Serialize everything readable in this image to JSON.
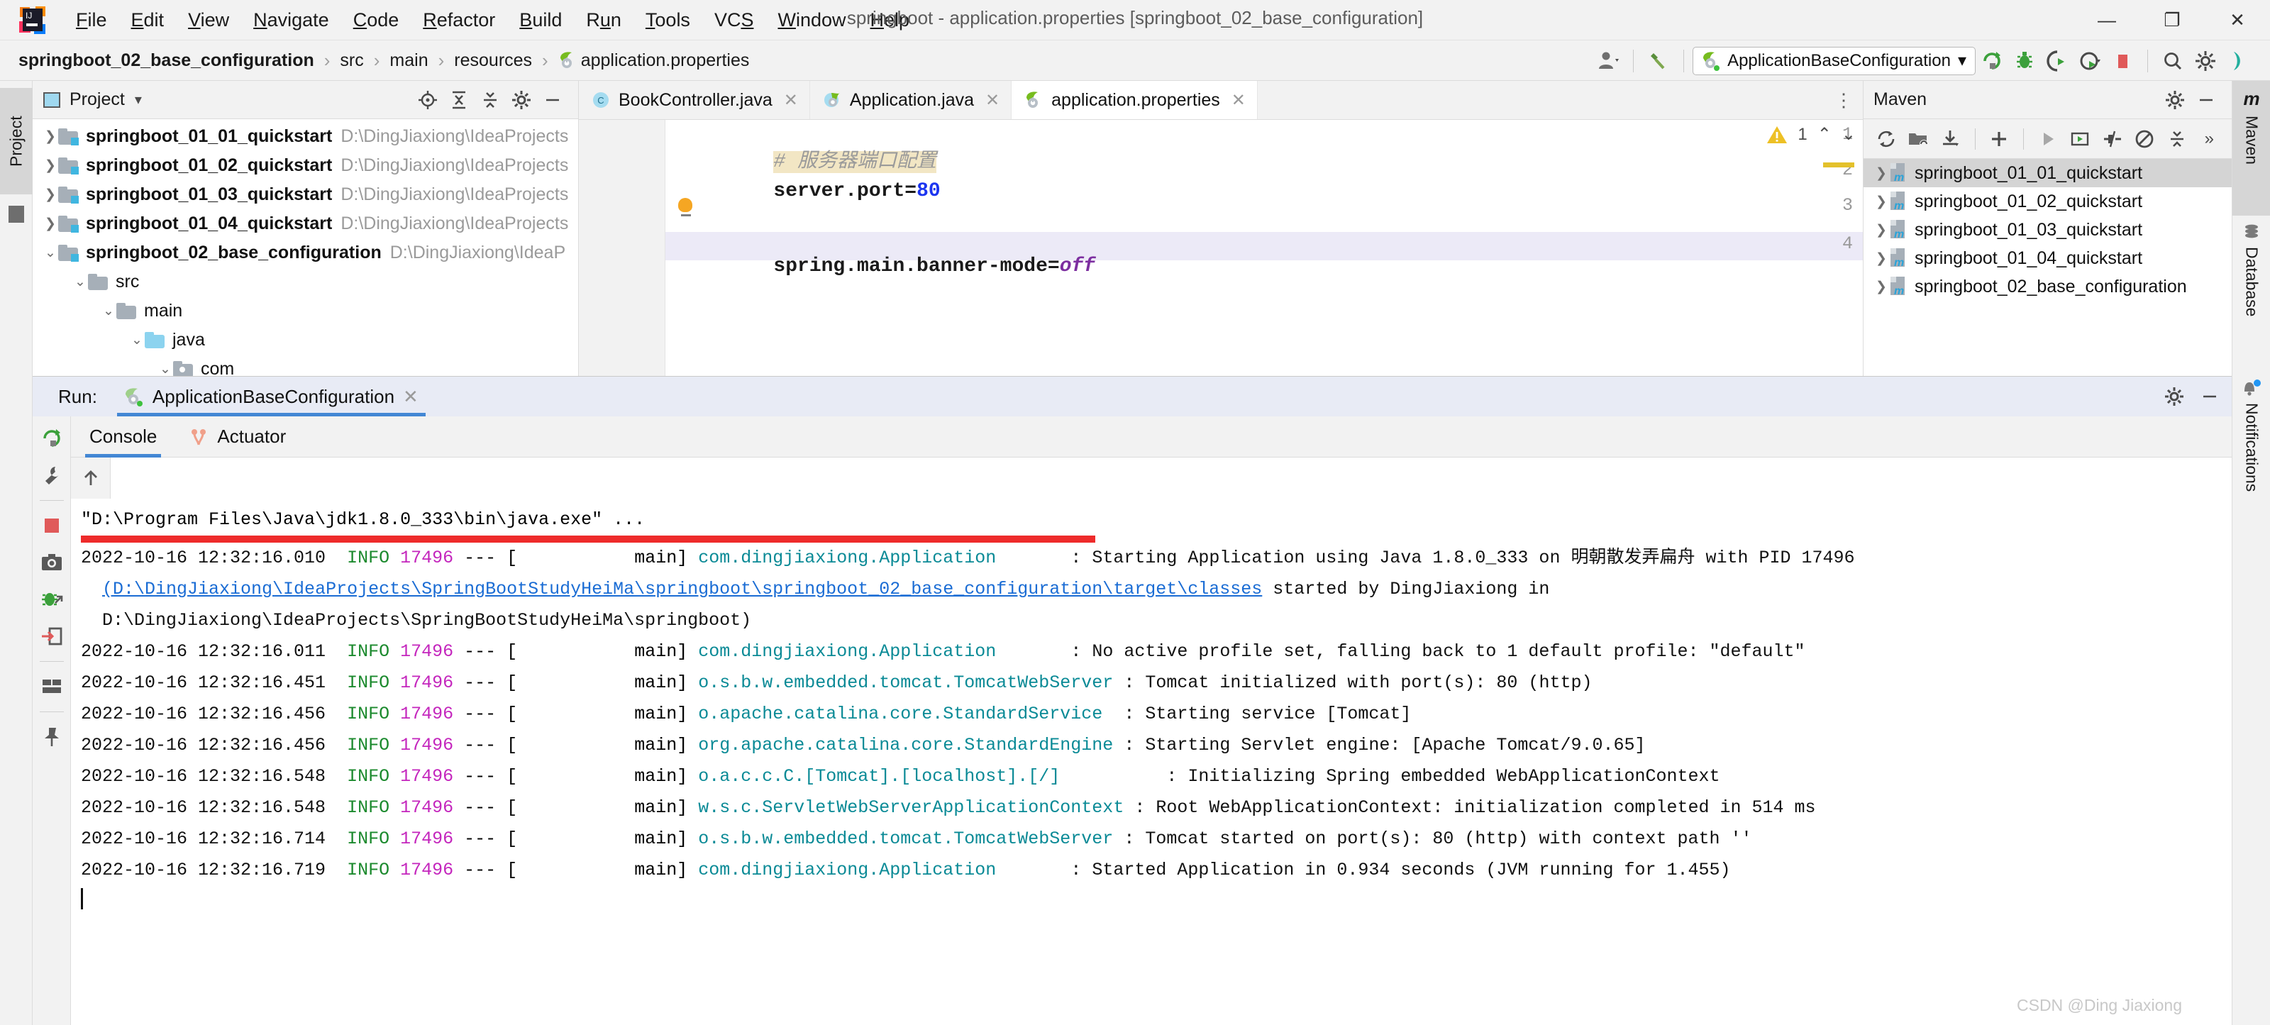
{
  "window": {
    "title": "springboot - application.properties [springboot_02_base_configuration]",
    "minimize": "—",
    "maximize": "❐",
    "close": "✕"
  },
  "menubar": [
    {
      "label": "File",
      "mnemonic": "F"
    },
    {
      "label": "Edit",
      "mnemonic": "E"
    },
    {
      "label": "View",
      "mnemonic": "V"
    },
    {
      "label": "Navigate",
      "mnemonic": "N"
    },
    {
      "label": "Code",
      "mnemonic": "C"
    },
    {
      "label": "Refactor",
      "mnemonic": "R"
    },
    {
      "label": "Build",
      "mnemonic": "B"
    },
    {
      "label": "Run",
      "mnemonic": "u"
    },
    {
      "label": "Tools",
      "mnemonic": "T"
    },
    {
      "label": "VCS",
      "mnemonic": "S"
    },
    {
      "label": "Window",
      "mnemonic": "W"
    },
    {
      "label": "Help",
      "mnemonic": "H"
    }
  ],
  "breadcrumb": {
    "items": [
      "springboot_02_base_configuration",
      "src",
      "main",
      "resources",
      "application.properties"
    ],
    "separator": "›"
  },
  "toolbar": {
    "run_configuration": "ApplicationBaseConfiguration",
    "dropdown_arrow": "▾",
    "icons": [
      "user-avatar-icon",
      "build-hammer-icon",
      "rerun-icon",
      "debug-icon",
      "run-with-coverage-icon",
      "profiler-icon",
      "stop-icon",
      "search-everywhere-icon",
      "settings-gear-icon",
      "idea-help-icon"
    ]
  },
  "left_strip": {
    "tab": "Project"
  },
  "project_panel": {
    "title": "Project",
    "dropdown_arrow": "▾",
    "header_icons": [
      "locate-icon",
      "expand-all-icon",
      "collapse-all-icon",
      "settings-gear-icon",
      "hide-icon"
    ],
    "tree": [
      {
        "label": "springboot_01_01_quickstart",
        "path": "D:\\DingJiaxiong\\IdeaProjects",
        "indent": 0,
        "expanded": false,
        "bold": true,
        "icon": "module-folder-icon"
      },
      {
        "label": "springboot_01_02_quickstart",
        "path": "D:\\DingJiaxiong\\IdeaProjects",
        "indent": 0,
        "expanded": false,
        "bold": true,
        "icon": "module-folder-icon"
      },
      {
        "label": "springboot_01_03_quickstart",
        "path": "D:\\DingJiaxiong\\IdeaProjects",
        "indent": 0,
        "expanded": false,
        "bold": true,
        "icon": "module-folder-icon"
      },
      {
        "label": "springboot_01_04_quickstart",
        "path": "D:\\DingJiaxiong\\IdeaProjects",
        "indent": 0,
        "expanded": false,
        "bold": true,
        "icon": "module-folder-icon"
      },
      {
        "label": "springboot_02_base_configuration",
        "path": "D:\\DingJiaxiong\\IdeaP",
        "indent": 0,
        "expanded": true,
        "bold": true,
        "icon": "module-folder-icon"
      },
      {
        "label": "src",
        "path": "",
        "indent": 1,
        "expanded": true,
        "bold": false,
        "icon": "folder-icon"
      },
      {
        "label": "main",
        "path": "",
        "indent": 2,
        "expanded": true,
        "bold": false,
        "icon": "folder-icon"
      },
      {
        "label": "java",
        "path": "",
        "indent": 3,
        "expanded": true,
        "bold": false,
        "icon": "source-folder-icon"
      },
      {
        "label": "com",
        "path": "",
        "indent": 4,
        "expanded": true,
        "bold": false,
        "icon": "package-folder-icon"
      }
    ]
  },
  "editor": {
    "tabs": [
      {
        "label": "BookController.java",
        "icon": "java-class-icon",
        "active": false,
        "closable": true
      },
      {
        "label": "Application.java",
        "icon": "spring-boot-class-icon",
        "active": false,
        "closable": true
      },
      {
        "label": "application.properties",
        "icon": "spring-properties-icon",
        "active": true,
        "closable": true
      }
    ],
    "tab_overflow": "⋮",
    "inspection": {
      "warning_count": "1",
      "warning_icon": "warning-triangle-icon",
      "prev": "⌃",
      "next": "⌄"
    },
    "lines": [
      {
        "num": "1",
        "kind": "comment",
        "text": "# 服务器端口配置"
      },
      {
        "num": "2",
        "kind": "kv",
        "key": "server.port",
        "eq": "=",
        "value": "80",
        "value_type": "number"
      },
      {
        "num": "3",
        "kind": "blank",
        "text": ""
      },
      {
        "num": "4",
        "kind": "kv",
        "key": "spring.main.banner-mode",
        "eq": "=",
        "value": "off",
        "value_type": "literal",
        "highlighted": true
      }
    ]
  },
  "maven_panel": {
    "title": "Maven",
    "header_icons": [
      "settings-gear-icon",
      "hide-icon"
    ],
    "toolbar_icons": [
      "reload-icon",
      "add-maven-project-icon",
      "download-sources-icon",
      "add-icon",
      "execute-goal-icon",
      "run-configuration-icon",
      "toggle-skip-tests-icon",
      "toggle-offline-icon",
      "collapse-all-icon",
      "more-icon"
    ],
    "more_label": "»",
    "tree": [
      {
        "label": "springboot_01_01_quickstart",
        "selected": true
      },
      {
        "label": "springboot_01_02_quickstart",
        "selected": false
      },
      {
        "label": "springboot_01_03_quickstart",
        "selected": false
      },
      {
        "label": "springboot_01_04_quickstart",
        "selected": false
      },
      {
        "label": "springboot_02_base_configuration",
        "selected": false
      }
    ]
  },
  "right_strip": {
    "tabs": [
      {
        "label": "Maven",
        "icon": "maven-m-icon",
        "active": true
      },
      {
        "label": "Database",
        "icon": "database-icon",
        "active": false
      },
      {
        "label": "Notifications",
        "icon": "notification-bell-icon",
        "active": false
      }
    ]
  },
  "run_panel": {
    "label": "Run:",
    "config_name": "ApplicationBaseConfiguration",
    "close": "✕",
    "header_icons": [
      "settings-gear-icon",
      "hide-icon"
    ],
    "tabs": [
      {
        "label": "Console",
        "icon": "console-icon",
        "active": true
      },
      {
        "label": "Actuator",
        "icon": "actuator-icon",
        "active": false
      }
    ],
    "sidebar_icons": [
      "rerun-icon",
      "wrench-icon",
      "stop-icon",
      "screenshot-icon",
      "debug-attach-icon",
      "export-icon",
      "layout-icon",
      "pin-icon"
    ],
    "console_side_icons": [
      "scroll-up-icon",
      "scroll-down-icon",
      "soft-wrap-icon",
      "scroll-to-end-icon",
      "print-icon",
      "clear-all-icon"
    ]
  },
  "console": {
    "command_line": "\"D:\\Program Files\\Java\\jdk1.8.0_333\\bin\\java.exe\" ...",
    "redacted_bar": true,
    "lines": [
      {
        "date": "2022-10-16 12:32:16.010",
        "level": "INFO",
        "pid": "17496",
        "sep": "--- [",
        "thread": "main]",
        "logger": "com.dingjiaxiong.Application",
        "message": ": Starting Application using Java 1.8.0_333 on 明朝散发弄扁舟 with PID 17496"
      },
      {
        "continuation": true,
        "link": "(D:\\DingJiaxiong\\IdeaProjects\\SpringBootStudyHeiMa\\springboot\\springboot_02_base_configuration\\target\\classes",
        "tail": " started by DingJiaxiong in"
      },
      {
        "continuation": true,
        "plain": "D:\\DingJiaxiong\\IdeaProjects\\SpringBootStudyHeiMa\\springboot)"
      },
      {
        "date": "2022-10-16 12:32:16.011",
        "level": "INFO",
        "pid": "17496",
        "sep": "--- [",
        "thread": "main]",
        "logger": "com.dingjiaxiong.Application",
        "message": ": No active profile set, falling back to 1 default profile: \"default\""
      },
      {
        "date": "2022-10-16 12:32:16.451",
        "level": "INFO",
        "pid": "17496",
        "sep": "--- [",
        "thread": "main]",
        "logger": "o.s.b.w.embedded.tomcat.TomcatWebServer",
        "message": ": Tomcat initialized with port(s): 80 (http)"
      },
      {
        "date": "2022-10-16 12:32:16.456",
        "level": "INFO",
        "pid": "17496",
        "sep": "--- [",
        "thread": "main]",
        "logger": "o.apache.catalina.core.StandardService",
        "message": ": Starting service [Tomcat]"
      },
      {
        "date": "2022-10-16 12:32:16.456",
        "level": "INFO",
        "pid": "17496",
        "sep": "--- [",
        "thread": "main]",
        "logger": "org.apache.catalina.core.StandardEngine",
        "message": ": Starting Servlet engine: [Apache Tomcat/9.0.65]"
      },
      {
        "date": "2022-10-16 12:32:16.548",
        "level": "INFO",
        "pid": "17496",
        "sep": "--- [",
        "thread": "main]",
        "logger": "o.a.c.c.C.[Tomcat].[localhost].[/]",
        "message": ": Initializing Spring embedded WebApplicationContext"
      },
      {
        "date": "2022-10-16 12:32:16.548",
        "level": "INFO",
        "pid": "17496",
        "sep": "--- [",
        "thread": "main]",
        "logger": "w.s.c.ServletWebServerApplicationContext",
        "message": ": Root WebApplicationContext: initialization completed in 514 ms"
      },
      {
        "date": "2022-10-16 12:32:16.714",
        "level": "INFO",
        "pid": "17496",
        "sep": "--- [",
        "thread": "main]",
        "logger": "o.s.b.w.embedded.tomcat.TomcatWebServer",
        "message": ": Tomcat started on port(s): 80 (http) with context path ''"
      },
      {
        "date": "2022-10-16 12:32:16.719",
        "level": "INFO",
        "pid": "17496",
        "sep": "--- [",
        "thread": "main]",
        "logger": "com.dingjiaxiong.Application",
        "message": ": Started Application in 0.934 seconds (JVM running for 1.455)"
      }
    ]
  },
  "watermark": "CSDN @Ding Jiaxiong",
  "colors": {
    "accent_blue": "#4387d4",
    "info_green": "#1c8a2e",
    "pid_magenta": "#c426bd",
    "logger_teal": "#0a8a96",
    "link_blue": "#1a6cd4",
    "warning_yellow": "#e3c12b",
    "stop_red": "#ee2b2b",
    "comment_bg": "#f2e6c4",
    "selected_line_bg": "#eceaf7"
  }
}
